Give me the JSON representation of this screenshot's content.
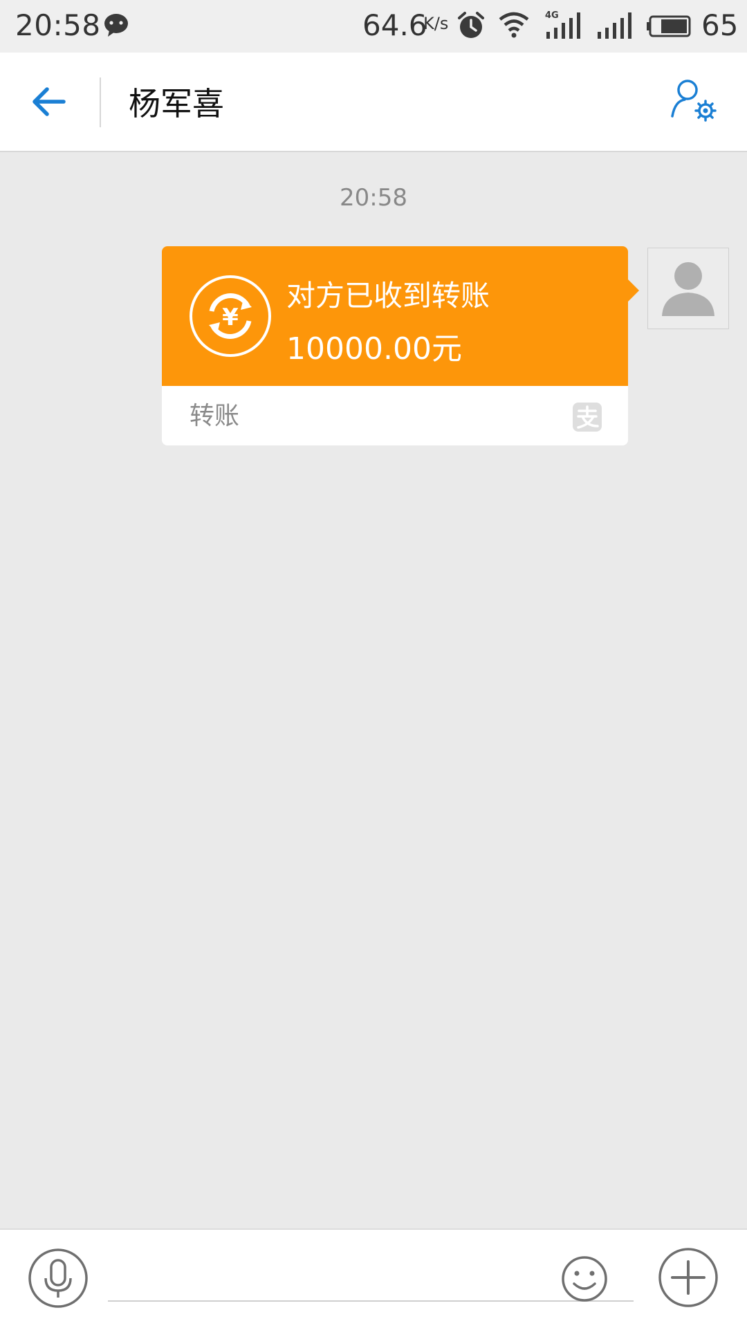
{
  "status_bar": {
    "time": "20:58",
    "network_speed": "64.6",
    "speed_unit": "K/s",
    "network_type": "4G",
    "battery": "65"
  },
  "header": {
    "title": "杨军喜"
  },
  "chat": {
    "timestamp": "20:58",
    "messages": [
      {
        "type": "transfer",
        "status": "对方已收到转账",
        "amount": "10000.00元",
        "label": "转账"
      }
    ]
  },
  "input": {
    "placeholder": ""
  },
  "colors": {
    "accent": "#1a7fd4",
    "transfer_orange": "#fd960a",
    "background": "#eaeaea"
  },
  "icons": {
    "back": "arrow-left-icon",
    "contact_settings": "user-settings-icon",
    "transfer": "yuan-refresh-icon",
    "alipay": "alipay-icon",
    "avatar": "default-avatar-icon",
    "mic": "microphone-icon",
    "emoji": "smiley-icon",
    "plus": "plus-icon"
  }
}
